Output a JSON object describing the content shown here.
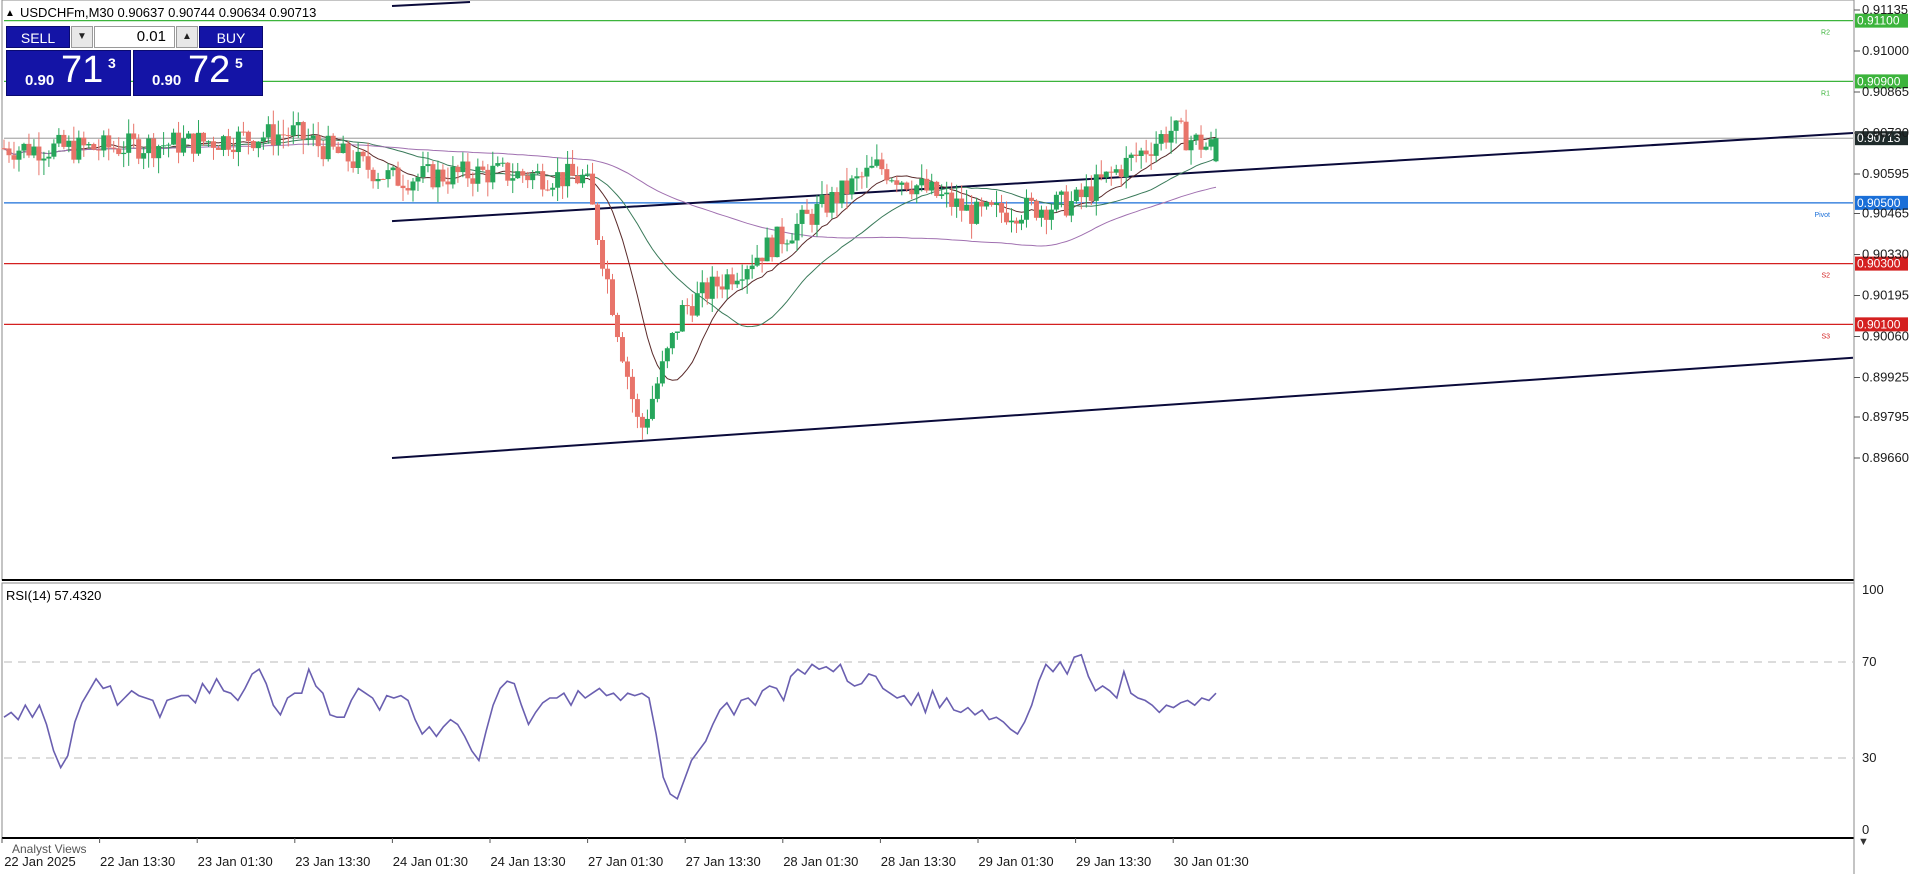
{
  "header": {
    "symbol_line": "USDCHFm,M30  0.90637 0.90744 0.90634 0.90713"
  },
  "trade_panel": {
    "sell_label": "SELL",
    "buy_label": "BUY",
    "lot": "0.01",
    "sell_price_prefix": "0.90",
    "sell_price_big": "71",
    "sell_price_sup": "3",
    "buy_price_prefix": "0.90",
    "buy_price_big": "72",
    "buy_price_sup": "5"
  },
  "indicator": {
    "label": "RSI(14) 57.4320"
  },
  "bottom": {
    "analyst_views": "Analyst Views"
  },
  "colors": {
    "bull": "#26a65b",
    "bear": "#e8746a",
    "green_level": "#3cb43c",
    "red_level": "#d42020",
    "blue_level": "#1a6fd8",
    "rsi": "#6a5fb0",
    "current_price_tag": "#1f2b2b"
  },
  "chart_data": [
    {
      "type": "candlestick",
      "title": "USDCHFm,M30",
      "ohlc_header": {
        "open": 0.90637,
        "high": 0.90744,
        "low": 0.90634,
        "close": 0.90713
      },
      "y_ticks": [
        "0.91135",
        "0.91000",
        "0.90865",
        "0.90730",
        "0.90595",
        "0.90465",
        "0.90330",
        "0.90195",
        "0.90060",
        "0.89925",
        "0.89795",
        "0.89660"
      ],
      "ylim": [
        0.8963,
        0.91165
      ],
      "x_ticks": [
        "22 Jan 2025",
        "22 Jan 13:30",
        "23 Jan 01:30",
        "23 Jan 13:30",
        "24 Jan 01:30",
        "24 Jan 13:30",
        "27 Jan 01:30",
        "27 Jan 13:30",
        "28 Jan 01:30",
        "28 Jan 13:30",
        "29 Jan 01:30",
        "29 Jan 13:30",
        "30 Jan 01:30"
      ],
      "current_price": "0.90713",
      "horizontal_levels": [
        {
          "price": "0.91100",
          "tag": "R2",
          "color": "green"
        },
        {
          "price": "0.90900",
          "tag": "R1",
          "color": "green"
        },
        {
          "price": "0.90500",
          "tag": "Pivot",
          "color": "blue"
        },
        {
          "price": "0.90300",
          "tag": "S2",
          "color": "red"
        },
        {
          "price": "0.90100",
          "tag": "S3",
          "color": "red"
        }
      ],
      "trend_lines": [
        {
          "from": [
            "24 Jan 01:30",
            0.9044
          ],
          "to": [
            "30 Jan (right edge)",
            0.9073
          ]
        },
        {
          "from": [
            "24 Jan 01:30",
            0.8966
          ],
          "to": [
            "30 Jan (right edge)",
            0.8999
          ]
        }
      ],
      "close_path_approx": [
        [
          "22 Jan 2025",
          0.9068
        ],
        [
          "22 Jan 13:30",
          0.9068
        ],
        [
          "23 Jan 01:30",
          0.907
        ],
        [
          "23 Jan 13:30",
          0.9073
        ],
        [
          "24 Jan 01:30",
          0.9058
        ],
        [
          "24 Jan 13:30",
          0.906
        ],
        [
          "27 Jan 01:30",
          0.9058
        ],
        [
          "27 Jan 05:30",
          0.8974
        ],
        [
          "27 Jan 13:30",
          0.9015
        ],
        [
          "28 Jan 01:30",
          0.9062
        ],
        [
          "28 Jan 13:30",
          0.9046
        ],
        [
          "29 Jan 01:30",
          0.905
        ],
        [
          "29 Jan 13:30",
          0.9074
        ],
        [
          "30 Jan 01:30",
          0.9068
        ],
        [
          "30 Jan 03:30",
          0.90713
        ]
      ]
    },
    {
      "type": "line",
      "title": "RSI(14) 57.4320",
      "y_ticks": [
        "100",
        "70",
        "30",
        "0"
      ],
      "ylim": [
        0,
        100
      ],
      "levels": [
        70,
        30
      ],
      "series": [
        {
          "name": "RSI(14)",
          "values": [
            47,
            49,
            46,
            52,
            47,
            52,
            44,
            33,
            26,
            31,
            45,
            53,
            58,
            63,
            59,
            60,
            52,
            55,
            58,
            56,
            55,
            54,
            47,
            54,
            55,
            56,
            56,
            53,
            61,
            57,
            63,
            58,
            57,
            54,
            59,
            65,
            67,
            61,
            52,
            48,
            55,
            57,
            57,
            67,
            60,
            57,
            48,
            47,
            47,
            54,
            59,
            57,
            55,
            50,
            56,
            55,
            56,
            54,
            46,
            40,
            43,
            39,
            43,
            46,
            44,
            39,
            33,
            29,
            41,
            52,
            59,
            62,
            61,
            52,
            44,
            49,
            53,
            55,
            55,
            57,
            52,
            58,
            55,
            57,
            59,
            56,
            57,
            54,
            57,
            56,
            57,
            55,
            40,
            22,
            15,
            13,
            21,
            29,
            33,
            37,
            44,
            50,
            53,
            48,
            54,
            55,
            52,
            58,
            60,
            59,
            54,
            64,
            67,
            65,
            69,
            67,
            68,
            66,
            69,
            62,
            60,
            61,
            65,
            64,
            59,
            57,
            55,
            56,
            52,
            57,
            49,
            58,
            51,
            55,
            50,
            49,
            51,
            48,
            50,
            46,
            47,
            45,
            42,
            40,
            45,
            52,
            62,
            69,
            66,
            70,
            65,
            72,
            73,
            64,
            58,
            60,
            58,
            55,
            66,
            57,
            55,
            54,
            52,
            49,
            52,
            51,
            53,
            54,
            52,
            55,
            54,
            57
          ]
        }
      ]
    }
  ]
}
